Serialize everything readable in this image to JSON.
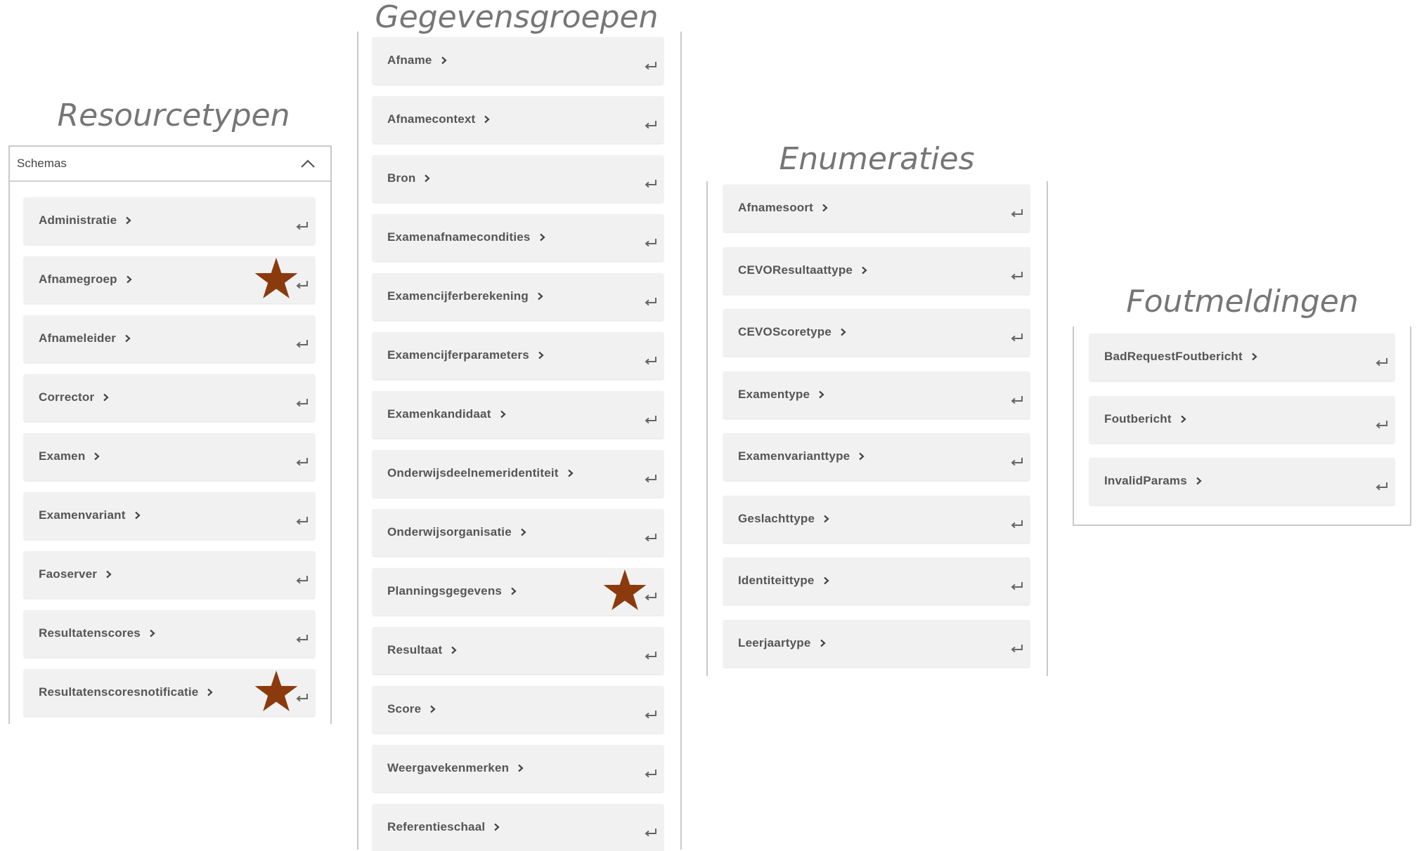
{
  "resourcetypen": {
    "heading": "Resourcetypen",
    "schemas_label": "Schemas",
    "items": [
      {
        "label": "Administratie",
        "starred": false
      },
      {
        "label": "Afnamegroep",
        "starred": true
      },
      {
        "label": "Afnameleider",
        "starred": false
      },
      {
        "label": "Corrector",
        "starred": false
      },
      {
        "label": "Examen",
        "starred": false
      },
      {
        "label": "Examenvariant",
        "starred": false
      },
      {
        "label": "Faoserver",
        "starred": false
      },
      {
        "label": "Resultatenscores",
        "starred": false
      },
      {
        "label": "Resultatenscoresnotificatie",
        "starred": true
      }
    ]
  },
  "gegevensgroepen": {
    "heading": "Gegevensgroepen",
    "items": [
      {
        "label": "Afname",
        "starred": false
      },
      {
        "label": "Afnamecontext",
        "starred": false
      },
      {
        "label": "Bron",
        "starred": false
      },
      {
        "label": "Examenafnamecondities",
        "starred": false
      },
      {
        "label": "Examencijferberekening",
        "starred": false
      },
      {
        "label": "Examencijferparameters",
        "starred": false
      },
      {
        "label": "Examenkandidaat",
        "starred": false
      },
      {
        "label": "Onderwijsdeelnemeridentiteit",
        "starred": false
      },
      {
        "label": "Onderwijsorganisatie",
        "starred": false
      },
      {
        "label": "Planningsgegevens",
        "starred": true
      },
      {
        "label": "Resultaat",
        "starred": false
      },
      {
        "label": "Score",
        "starred": false
      },
      {
        "label": "Weergavekenmerken",
        "starred": false
      },
      {
        "label": "Referentieschaal",
        "starred": false
      }
    ]
  },
  "enumeraties": {
    "heading": "Enumeraties",
    "items": [
      {
        "label": "Afnamesoort",
        "starred": false
      },
      {
        "label": "CEVOResultaattype",
        "starred": false
      },
      {
        "label": "CEVOScoretype",
        "starred": false
      },
      {
        "label": "Examentype",
        "starred": false
      },
      {
        "label": "Examenvarianttype",
        "starred": false
      },
      {
        "label": "Geslachttype",
        "starred": false
      },
      {
        "label": "Identiteittype",
        "starred": false
      },
      {
        "label": "Leerjaartype",
        "starred": false
      }
    ]
  },
  "foutmeldingen": {
    "heading": "Foutmeldingen",
    "items": [
      {
        "label": "BadRequestFoutbericht",
        "starred": false
      },
      {
        "label": "Foutbericht",
        "starred": false
      },
      {
        "label": "InvalidParams",
        "starred": false
      }
    ]
  },
  "colors": {
    "star": "#8b3a0e",
    "heading": "#767676",
    "item_bg": "#f1f1f1",
    "item_text": "#555555"
  },
  "icons": {
    "item_chevron": "chevron-right-icon",
    "item_enter": "enter-arrow-icon",
    "schemas_toggle": "chevron-up-icon",
    "favorite": "star-icon"
  }
}
